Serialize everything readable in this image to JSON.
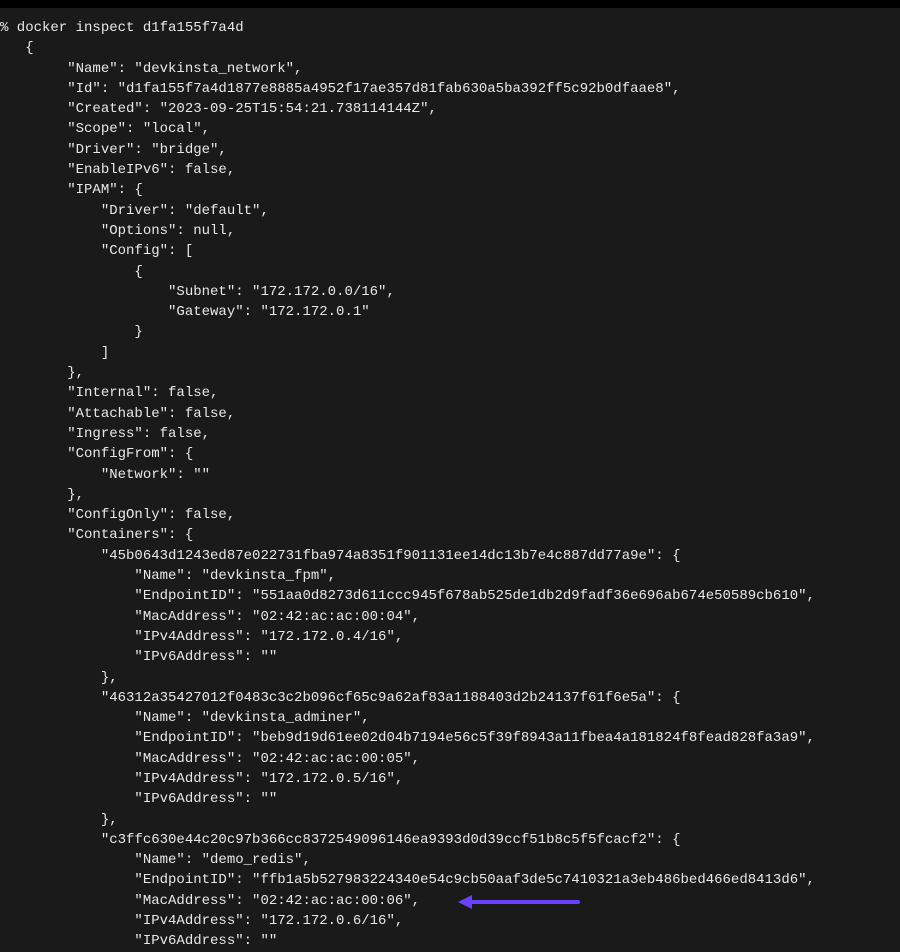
{
  "command": "% docker inspect d1fa155f7a4d",
  "output": [
    "",
    "   {",
    "        \"Name\": \"devkinsta_network\",",
    "        \"Id\": \"d1fa155f7a4d1877e8885a4952f17ae357d81fab630a5ba392ff5c92b0dfaae8\",",
    "        \"Created\": \"2023-09-25T15:54:21.738114144Z\",",
    "        \"Scope\": \"local\",",
    "        \"Driver\": \"bridge\",",
    "        \"EnableIPv6\": false,",
    "        \"IPAM\": {",
    "            \"Driver\": \"default\",",
    "            \"Options\": null,",
    "            \"Config\": [",
    "                {",
    "                    \"Subnet\": \"172.172.0.0/16\",",
    "                    \"Gateway\": \"172.172.0.1\"",
    "                }",
    "            ]",
    "        },",
    "        \"Internal\": false,",
    "        \"Attachable\": false,",
    "        \"Ingress\": false,",
    "        \"ConfigFrom\": {",
    "            \"Network\": \"\"",
    "        },",
    "        \"ConfigOnly\": false,",
    "        \"Containers\": {",
    "            \"45b0643d1243ed87e022731fba974a8351f901131ee14dc13b7e4c887dd77a9e\": {",
    "                \"Name\": \"devkinsta_fpm\",",
    "                \"EndpointID\": \"551aa0d8273d611ccc945f678ab525de1db2d9fadf36e696ab674e50589cb610\",",
    "                \"MacAddress\": \"02:42:ac:ac:00:04\",",
    "                \"IPv4Address\": \"172.172.0.4/16\",",
    "                \"IPv6Address\": \"\"",
    "            },",
    "            \"46312a35427012f0483c3c2b096cf65c9a62af83a1188403d2b24137f61f6e5a\": {",
    "                \"Name\": \"devkinsta_adminer\",",
    "                \"EndpointID\": \"beb9d19d61ee02d04b7194e56c5f39f8943a11fbea4a181824f8fead828fa3a9\",",
    "                \"MacAddress\": \"02:42:ac:ac:00:05\",",
    "                \"IPv4Address\": \"172.172.0.5/16\",",
    "                \"IPv6Address\": \"\"",
    "            },",
    "            \"c3ffc630e44c20c97b366cc8372549096146ea9393d0d39ccf51b8c5f5fcacf2\": {",
    "                \"Name\": \"demo_redis\",",
    "                \"EndpointID\": \"ffb1a5b527983224340e54c9cb50aaf3de5c7410321a3eb486bed466ed8413d6\",",
    "                \"MacAddress\": \"02:42:ac:ac:00:06\",",
    "                \"IPv4Address\": \"172.172.0.6/16\",",
    "                \"IPv6Address\": \"\"",
    "            },"
  ]
}
